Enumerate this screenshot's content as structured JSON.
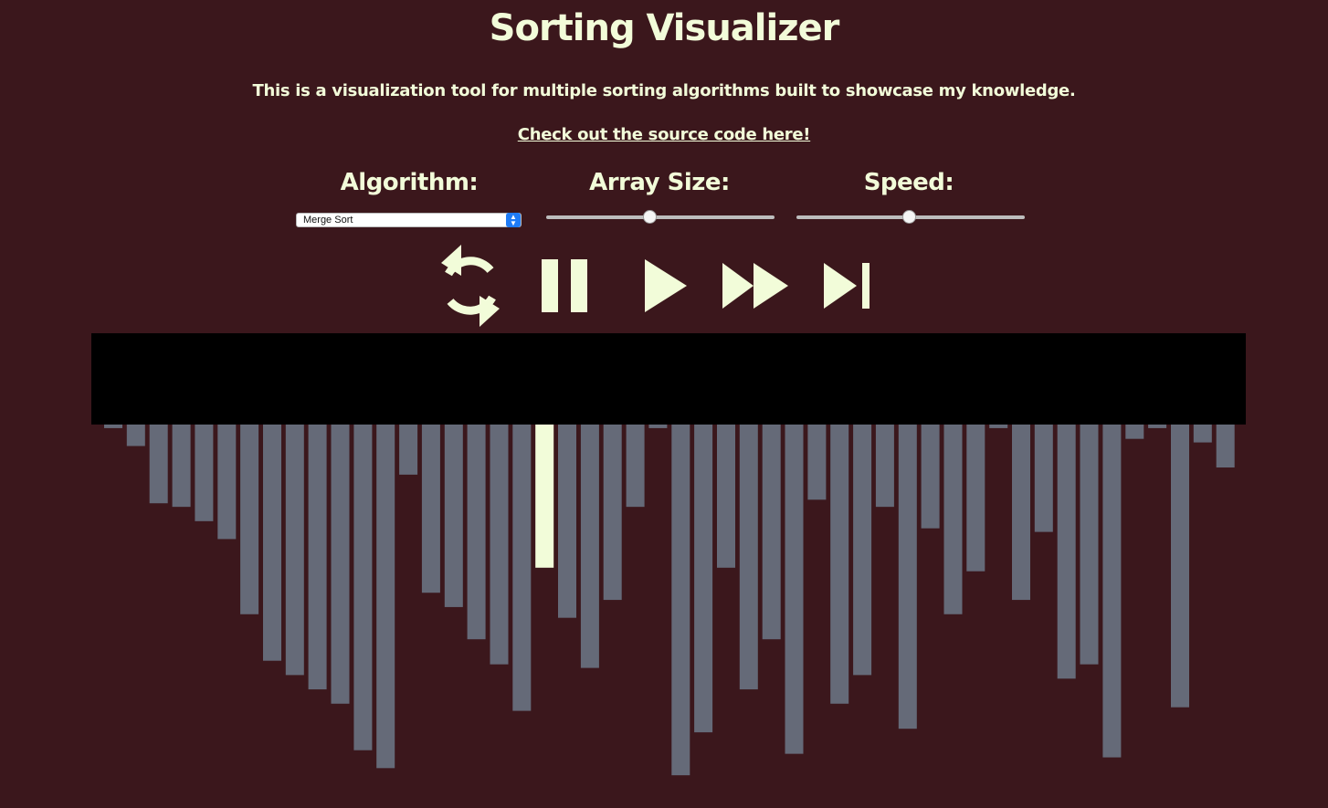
{
  "header": {
    "title": "Sorting Visualizer",
    "subtitle": "This is a visualization tool for multiple sorting algorithms built to showcase my knowledge.",
    "source_link": "Check out the source code here!"
  },
  "controls": {
    "algorithm_label": "Algorithm:",
    "algorithm_selected": "Merge Sort",
    "array_size_label": "Array Size:",
    "array_size_level": 0.45,
    "speed_label": "Speed:",
    "speed_level": 0.49
  },
  "buttons": {
    "reset": "reset-icon",
    "pause": "pause-icon",
    "play": "play-icon",
    "fast_forward": "fast-forward-icon",
    "skip": "skip-to-end-icon"
  },
  "colors": {
    "background": "#3b171c",
    "accent": "#f2fcd9",
    "bar": "#656a78",
    "highlight_bar": "#f2fcd9",
    "stage": "#000000"
  },
  "chart_data": {
    "type": "bar",
    "values": [
      4,
      24,
      88,
      92,
      108,
      128,
      212,
      264,
      280,
      296,
      312,
      364,
      384,
      56,
      188,
      204,
      240,
      268,
      320,
      160,
      216,
      272,
      196,
      92,
      4,
      392,
      344,
      160,
      296,
      240,
      368,
      84,
      312,
      280,
      92,
      340,
      116,
      212,
      164,
      4,
      196,
      120,
      284,
      268,
      372,
      16,
      4,
      316,
      20,
      48
    ],
    "highlight_index": 19,
    "ylim": [
      0,
      400
    ]
  }
}
